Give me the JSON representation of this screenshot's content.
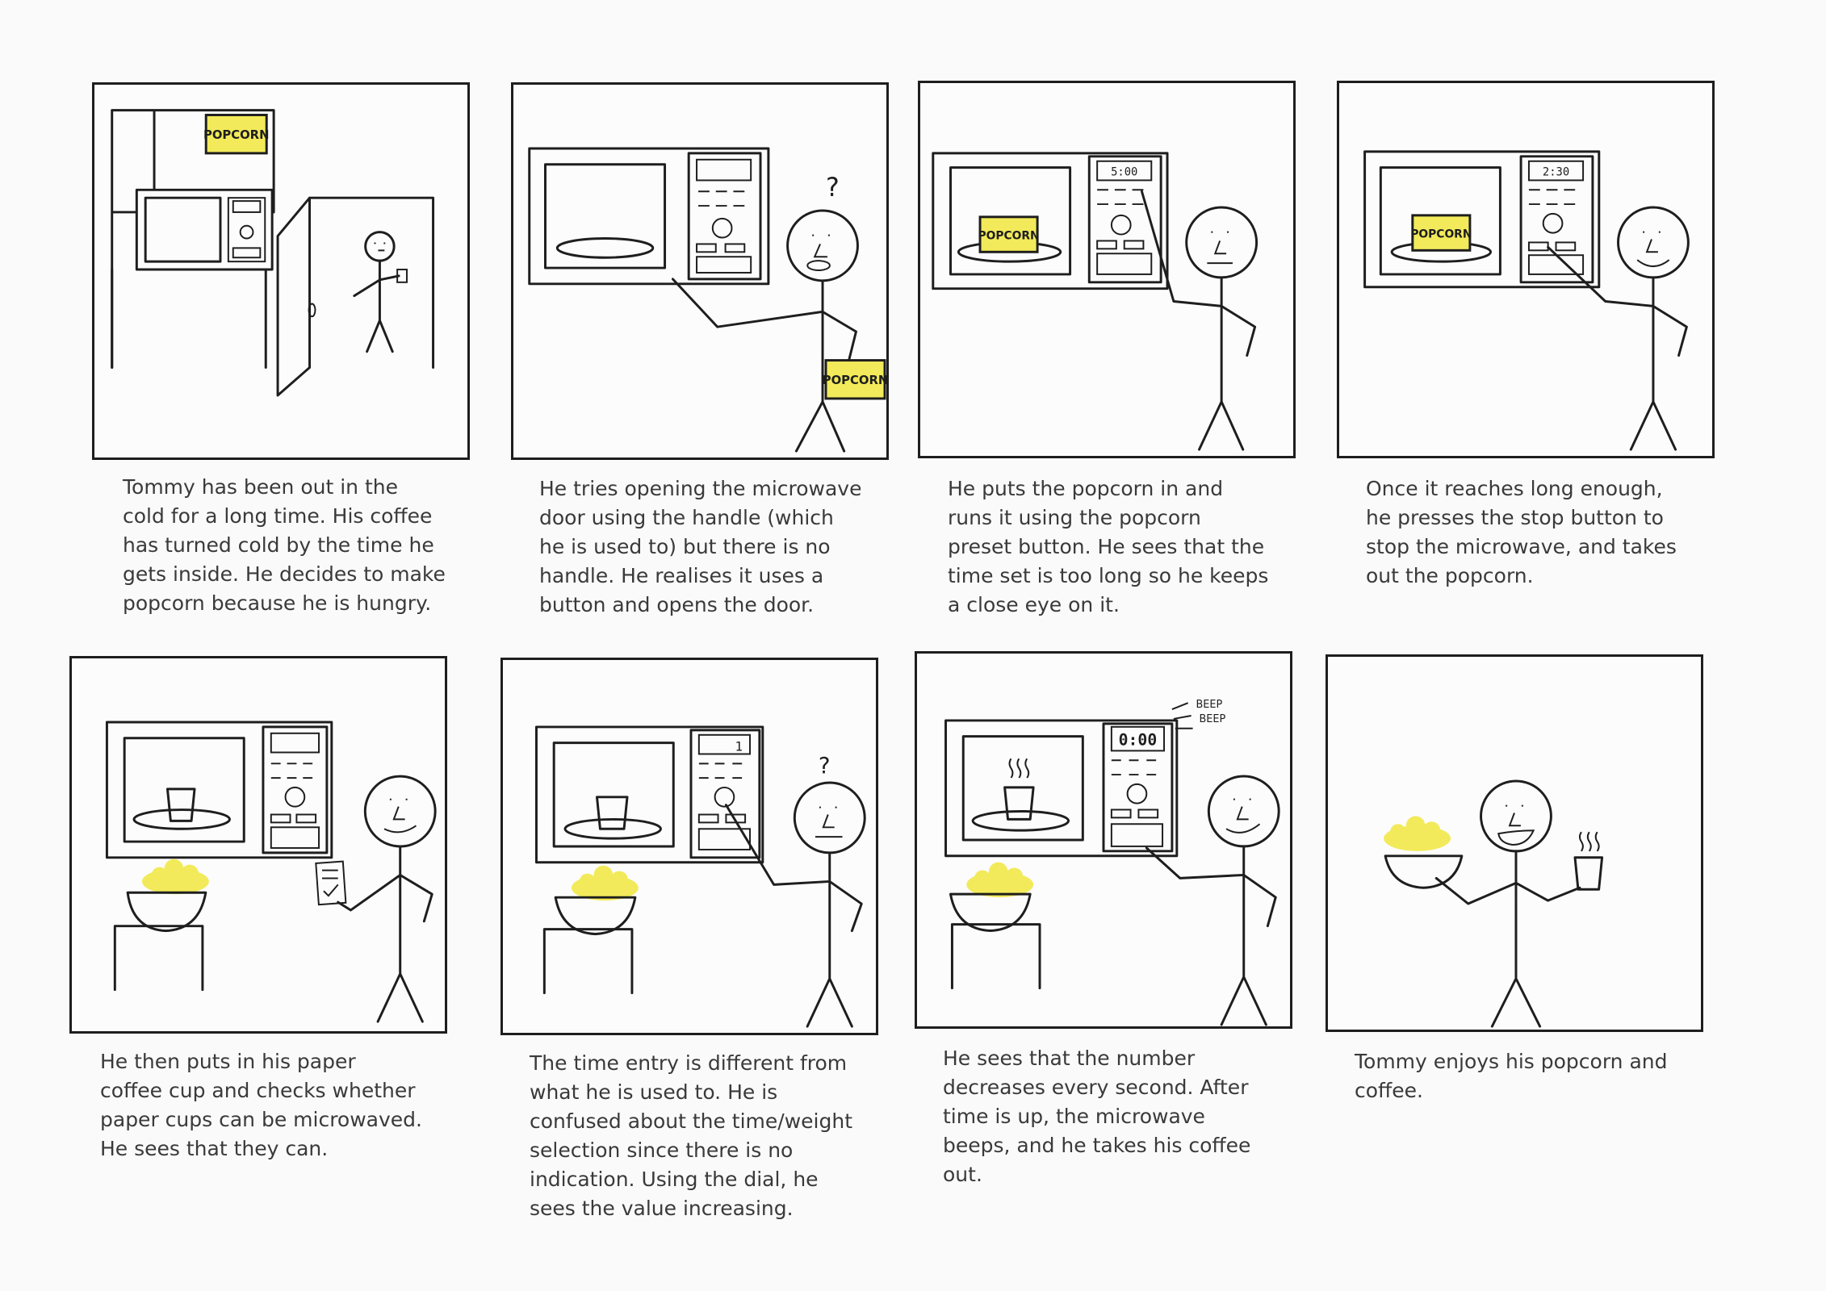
{
  "colors": {
    "ink": "#1e1e1e",
    "popcorn": "#f2ea5a",
    "caption": "#3a3a3a",
    "background": "#fafafa"
  },
  "labels": {
    "popcorn": "POPCORN",
    "question": "?",
    "beep1": "BEEP",
    "beep2": "BEEP"
  },
  "displays": {
    "p3": "5:00",
    "p4": "2:30",
    "p6": "1",
    "p7": "0:00"
  },
  "captions": {
    "p1": "Tommy has been out in the cold for a long time. His coffee has turned cold by the time he gets inside. He decides to make popcorn because he is hungry.",
    "p2": "He tries opening the microwave door using the handle (which he is used to) but there is no handle. He realises it uses a button and opens the door.",
    "p3": "He puts the popcorn in and runs it using the popcorn preset button. He sees that the time set is too long so he keeps a close eye on it.",
    "p4": "Once it reaches long enough, he presses the stop button to stop the microwave, and takes out the popcorn.",
    "p5": "He then puts in his paper coffee cup and checks whether paper cups can be microwaved. He sees that they can.",
    "p6": "The time entry is different from what he is used to. He is confused about the time/weight selection since there is no indication. Using the dial, he sees the value increasing.",
    "p7": "He sees that the number decreases every second. After time is up, the microwave beeps, and he takes his coffee out.",
    "p8": "Tommy enjoys his popcorn and coffee."
  }
}
